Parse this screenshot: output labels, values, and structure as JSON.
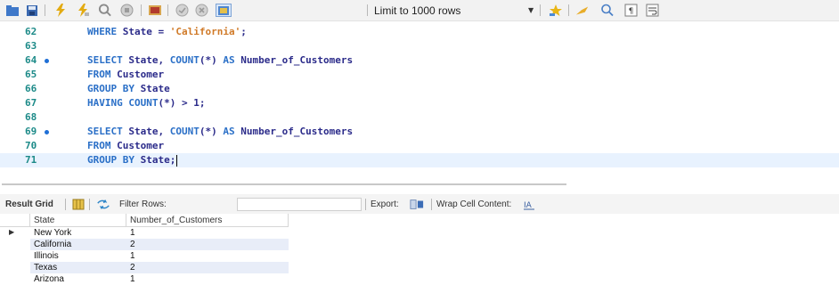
{
  "toolbar": {
    "limit_label": "Limit to 1000 rows",
    "colors": {
      "blue_icon": "#2f6fc7",
      "yellow_icon": "#e0a800",
      "gray_icon": "#9a9a9a"
    }
  },
  "editor": {
    "lines": [
      {
        "num": "62",
        "tokens": [
          {
            "t": "kw",
            "v": "WHERE "
          },
          {
            "t": "id",
            "v": "State "
          },
          {
            "t": "op",
            "v": "= "
          },
          {
            "t": "str",
            "v": "'California'"
          },
          {
            "t": "op",
            "v": ";"
          }
        ]
      },
      {
        "num": "63",
        "tokens": []
      },
      {
        "num": "64",
        "marker": true,
        "tokens": [
          {
            "t": "kw",
            "v": "SELECT "
          },
          {
            "t": "id",
            "v": "State"
          },
          {
            "t": "op",
            "v": ", "
          },
          {
            "t": "fn",
            "v": "COUNT"
          },
          {
            "t": "op",
            "v": "(*) "
          },
          {
            "t": "kw",
            "v": "AS "
          },
          {
            "t": "id",
            "v": "Number_of_Customers"
          }
        ]
      },
      {
        "num": "65",
        "tokens": [
          {
            "t": "kw",
            "v": "FROM "
          },
          {
            "t": "id",
            "v": "Customer"
          }
        ]
      },
      {
        "num": "66",
        "tokens": [
          {
            "t": "kw",
            "v": "GROUP BY "
          },
          {
            "t": "id",
            "v": "State"
          }
        ]
      },
      {
        "num": "67",
        "tokens": [
          {
            "t": "kw",
            "v": "HAVING "
          },
          {
            "t": "fn",
            "v": "COUNT"
          },
          {
            "t": "op",
            "v": "(*) > "
          },
          {
            "t": "num",
            "v": "1"
          },
          {
            "t": "op",
            "v": ";"
          }
        ]
      },
      {
        "num": "68",
        "tokens": []
      },
      {
        "num": "69",
        "marker": true,
        "tokens": [
          {
            "t": "kw",
            "v": "SELECT "
          },
          {
            "t": "id",
            "v": "State"
          },
          {
            "t": "op",
            "v": ", "
          },
          {
            "t": "fn",
            "v": "COUNT"
          },
          {
            "t": "op",
            "v": "(*) "
          },
          {
            "t": "kw",
            "v": "AS "
          },
          {
            "t": "id",
            "v": "Number_of_Customers"
          }
        ]
      },
      {
        "num": "70",
        "tokens": [
          {
            "t": "kw",
            "v": "FROM "
          },
          {
            "t": "id",
            "v": "Customer"
          }
        ]
      },
      {
        "num": "71",
        "current": true,
        "caret": true,
        "tokens": [
          {
            "t": "kw",
            "v": "GROUP BY "
          },
          {
            "t": "id",
            "v": "State"
          },
          {
            "t": "op",
            "v": ";"
          }
        ]
      }
    ]
  },
  "result_bar": {
    "result_grid_label": "Result Grid",
    "filter_label": "Filter Rows:",
    "filter_value": "",
    "export_label": "Export:",
    "wrap_label": "Wrap Cell Content:"
  },
  "grid": {
    "columns": [
      "State",
      "Number_of_Customers"
    ],
    "rows": [
      [
        "New York",
        "1"
      ],
      [
        "California",
        "2"
      ],
      [
        "Illinois",
        "1"
      ],
      [
        "Texas",
        "2"
      ],
      [
        "Arizona",
        "1"
      ]
    ]
  }
}
